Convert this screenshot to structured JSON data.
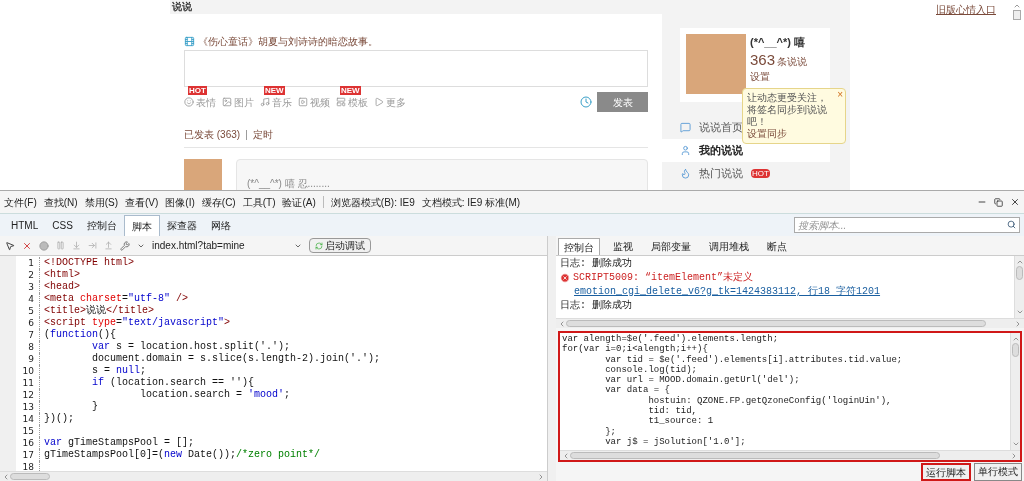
{
  "page": {
    "section_title": "说说",
    "old_version_link": "旧版心情入口",
    "promo": "《伤心童话》胡夏与刘诗诗的暗恋故事。",
    "tools": [
      {
        "kind": "smile",
        "label": "表情",
        "badge": "HOT"
      },
      {
        "kind": "image",
        "label": "图片"
      },
      {
        "kind": "music",
        "label": "音乐",
        "badge": "NEW"
      },
      {
        "kind": "video",
        "label": "视频"
      },
      {
        "kind": "template",
        "label": "模板",
        "badge": "NEW"
      },
      {
        "kind": "more",
        "label": "更多"
      }
    ],
    "submit": "发表",
    "published": "已发表 (363)",
    "separator": "|",
    "scheduled": "定时",
    "feed_text": "(*^__^*) 嘻 忍........",
    "profile": {
      "name": "(*^__^*) 嘻",
      "count": "363",
      "count_label": "条说说",
      "settings": "设置"
    },
    "tooltip": {
      "text": "让动态更受关注，将签名同步到说说吧！",
      "link": "设置同步",
      "close": "×"
    },
    "nav": [
      {
        "kind": "home",
        "label": "说说首页",
        "selected": false
      },
      {
        "kind": "mine",
        "label": "我的说说",
        "selected": true
      },
      {
        "kind": "hot",
        "label": "热门说说",
        "selected": false,
        "badge": "HOT"
      }
    ]
  },
  "devtools": {
    "menu": [
      "文件(F)",
      "查找(N)",
      "禁用(S)",
      "查看(V)",
      "图像(I)",
      "缓存(C)",
      "工具(T)",
      "验证(A)"
    ],
    "modes": [
      "浏览器模式(B): IE9",
      "文档模式: IE9 标准(M)"
    ],
    "tabs": [
      {
        "label": "HTML",
        "selected": false
      },
      {
        "label": "CSS",
        "selected": false
      },
      {
        "label": "控制台",
        "selected": false
      },
      {
        "label": "脚本",
        "selected": true
      },
      {
        "label": "探查器",
        "selected": false
      },
      {
        "label": "网络",
        "selected": false
      }
    ],
    "search_placeholder": "搜索脚本...",
    "file": "index.html?tab=mine",
    "debug_button": "启动调试",
    "code": [
      {
        "number": "1",
        "segments": [
          {
            "kind": "tag",
            "text": "<!DOCTYPE html>"
          }
        ]
      },
      {
        "number": "2",
        "segments": [
          {
            "kind": "tag",
            "text": "<html>"
          }
        ]
      },
      {
        "number": "3",
        "segments": [
          {
            "kind": "tag",
            "text": "<head>"
          }
        ]
      },
      {
        "number": "4",
        "segments": [
          {
            "kind": "tag",
            "text": "<meta "
          },
          {
            "kind": "attr",
            "text": "charset"
          },
          {
            "kind": "plain",
            "text": "="
          },
          {
            "kind": "str",
            "text": "\"utf-8\""
          },
          {
            "kind": "tag",
            "text": " />"
          }
        ]
      },
      {
        "number": "5",
        "segments": [
          {
            "kind": "tag",
            "text": "<title>"
          },
          {
            "kind": "plain",
            "text": "说说"
          },
          {
            "kind": "tag",
            "text": "</title>"
          }
        ]
      },
      {
        "number": "6",
        "segments": [
          {
            "kind": "tag",
            "text": "<script "
          },
          {
            "kind": "attr",
            "text": "type"
          },
          {
            "kind": "plain",
            "text": "="
          },
          {
            "kind": "str",
            "text": "\"text/javascript\""
          },
          {
            "kind": "tag",
            "text": ">"
          }
        ]
      },
      {
        "number": "7",
        "segments": [
          {
            "kind": "plain",
            "text": "("
          },
          {
            "kind": "kw",
            "text": "function"
          },
          {
            "kind": "plain",
            "text": "(){"
          }
        ]
      },
      {
        "number": "8",
        "segments": [
          {
            "kind": "kw",
            "text": "        var"
          },
          {
            "kind": "plain",
            "text": " s = location.host.split('.');"
          }
        ]
      },
      {
        "number": "9",
        "segments": [
          {
            "kind": "plain",
            "text": "        document.domain = s.slice(s.length-2).join('.');"
          }
        ]
      },
      {
        "number": "10",
        "segments": [
          {
            "kind": "plain",
            "text": "        s = "
          },
          {
            "kind": "kw",
            "text": "null"
          },
          {
            "kind": "plain",
            "text": ";"
          }
        ]
      },
      {
        "number": "11",
        "segments": [
          {
            "kind": "kw",
            "text": "        if"
          },
          {
            "kind": "plain",
            "text": " (location.search == ''){"
          }
        ]
      },
      {
        "number": "12",
        "segments": [
          {
            "kind": "plain",
            "text": "                location.search = "
          },
          {
            "kind": "str",
            "text": "'mood'"
          },
          {
            "kind": "plain",
            "text": ";"
          }
        ]
      },
      {
        "number": "13",
        "segments": [
          {
            "kind": "plain",
            "text": "        }"
          }
        ]
      },
      {
        "number": "14",
        "segments": [
          {
            "kind": "plain",
            "text": "})();"
          }
        ]
      },
      {
        "number": "15"
      },
      {
        "number": "16",
        "segments": [
          {
            "kind": "kw",
            "text": "var"
          },
          {
            "kind": "plain",
            "text": " gTimeStampsPool = [];"
          }
        ]
      },
      {
        "number": "17",
        "segments": [
          {
            "kind": "plain",
            "text": "gTimeStampsPool[0]=("
          },
          {
            "kind": "kw",
            "text": "new"
          },
          {
            "kind": "plain",
            "text": " Date());"
          },
          {
            "kind": "comment",
            "text": "/*zero point*/"
          }
        ]
      },
      {
        "number": "18"
      }
    ],
    "right_tabs": [
      {
        "label": "控制台",
        "selected": true
      },
      {
        "label": "监视",
        "selected": false
      },
      {
        "label": "局部变量",
        "selected": false
      },
      {
        "label": "调用堆栈",
        "selected": false
      },
      {
        "label": "断点",
        "selected": false
      }
    ],
    "log": [
      {
        "kind": "log",
        "text": "日志: 删除成功"
      },
      {
        "kind": "error",
        "text": "SCRIPT5009: “itemElement”未定义"
      },
      {
        "kind": "link",
        "text": "emotion_cgi_delete_v6?g_tk=1424383112, 行18 字符1201"
      },
      {
        "kind": "log",
        "text": "日志: 删除成功"
      }
    ],
    "input": [
      "var alength=$e('.feed').elements.length;",
      "for(var i=0;i<alength;i++){",
      "        var tid = $e('.feed').elements[i].attributes.tid.value;",
      "        console.log(tid);",
      "        var url = MOOD.domain.getUrl('del');",
      "        var data = {",
      "                hostuin: QZONE.FP.getQzoneConfig('loginUin'),",
      "                tid: tid,",
      "                t1_source: 1",
      "        };",
      "        var j$ = jSolution['1.0'];"
    ],
    "run_button": "运行脚本",
    "mode_button": "单行模式"
  }
}
